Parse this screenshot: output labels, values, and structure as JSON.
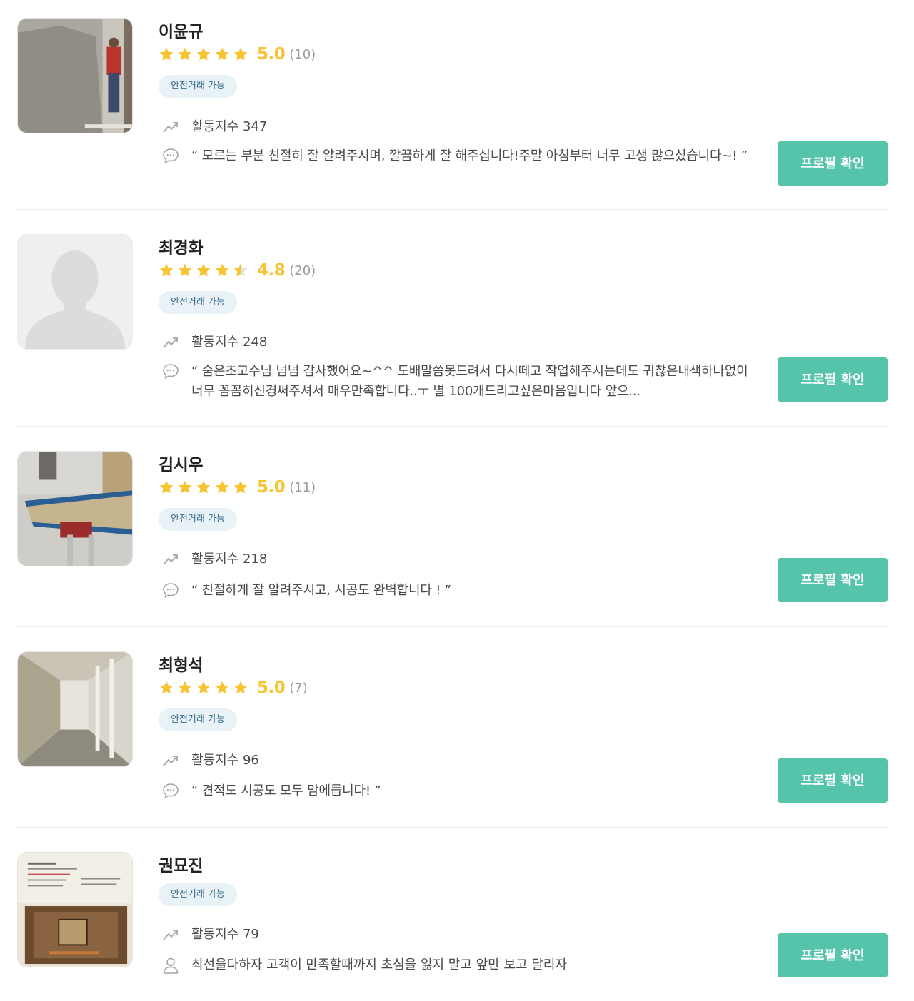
{
  "colors": {
    "accent": "#55c4ab",
    "star": "#f7c331",
    "badge_bg": "#e8f2f7",
    "badge_text": "#3a6c8a"
  },
  "experts": [
    {
      "name": "이윤규",
      "rating": "5.0",
      "stars": 5,
      "review_count": "(10)",
      "badge": "안전거래 가능",
      "activity": "활동지수 347",
      "review": "“ 모르는 부분 친절히 잘 알려주시며, 깔끔하게 잘 해주십니다!주말 아침부터 너무 고생 많으셨습니다~! ”",
      "button": "프로필 확인",
      "photo": "wall-plastering-photo"
    },
    {
      "name": "최경화",
      "rating": "4.8",
      "stars": 4.8,
      "review_count": "(20)",
      "badge": "안전거래 가능",
      "activity": "활동지수 248",
      "review": "“ 숨은초고수님 넘넘 감사했어요~^^ 도배말씀못드려서 다시떼고 작업해주시는데도 귀찮은내색하나없이 너무 꼼꼼히신경써주셔서 매우만족합니다..ㅜ 별 100개드리고싶은마음입니다 앞으...",
      "button": "프로필 확인",
      "photo": "default-avatar"
    },
    {
      "name": "김시우",
      "rating": "5.0",
      "stars": 5,
      "review_count": "(11)",
      "badge": "안전거래 가능",
      "activity": "활동지수 218",
      "review": "“ 친절하게 잘 알려주시고, 시공도 완벽합니다 ! ”",
      "button": "프로필 확인",
      "photo": "wood-board-photo"
    },
    {
      "name": "최형석",
      "rating": "5.0",
      "stars": 5,
      "review_count": "(7)",
      "badge": "안전거래 가능",
      "activity": "활동지수 96",
      "review": "“ 견적도 시공도 모두 맘에듭니다! ”",
      "button": "프로필 확인",
      "photo": "hallway-photo"
    },
    {
      "name": "권묘진",
      "badge": "안전거래 가능",
      "activity": "활동지수 79",
      "intro": "최선을다하자 고객이 만족할때까지 초심을 잃지 말고 앞만 보고 달리자",
      "button": "프로필 확인",
      "photo": "business-card-photo"
    }
  ]
}
